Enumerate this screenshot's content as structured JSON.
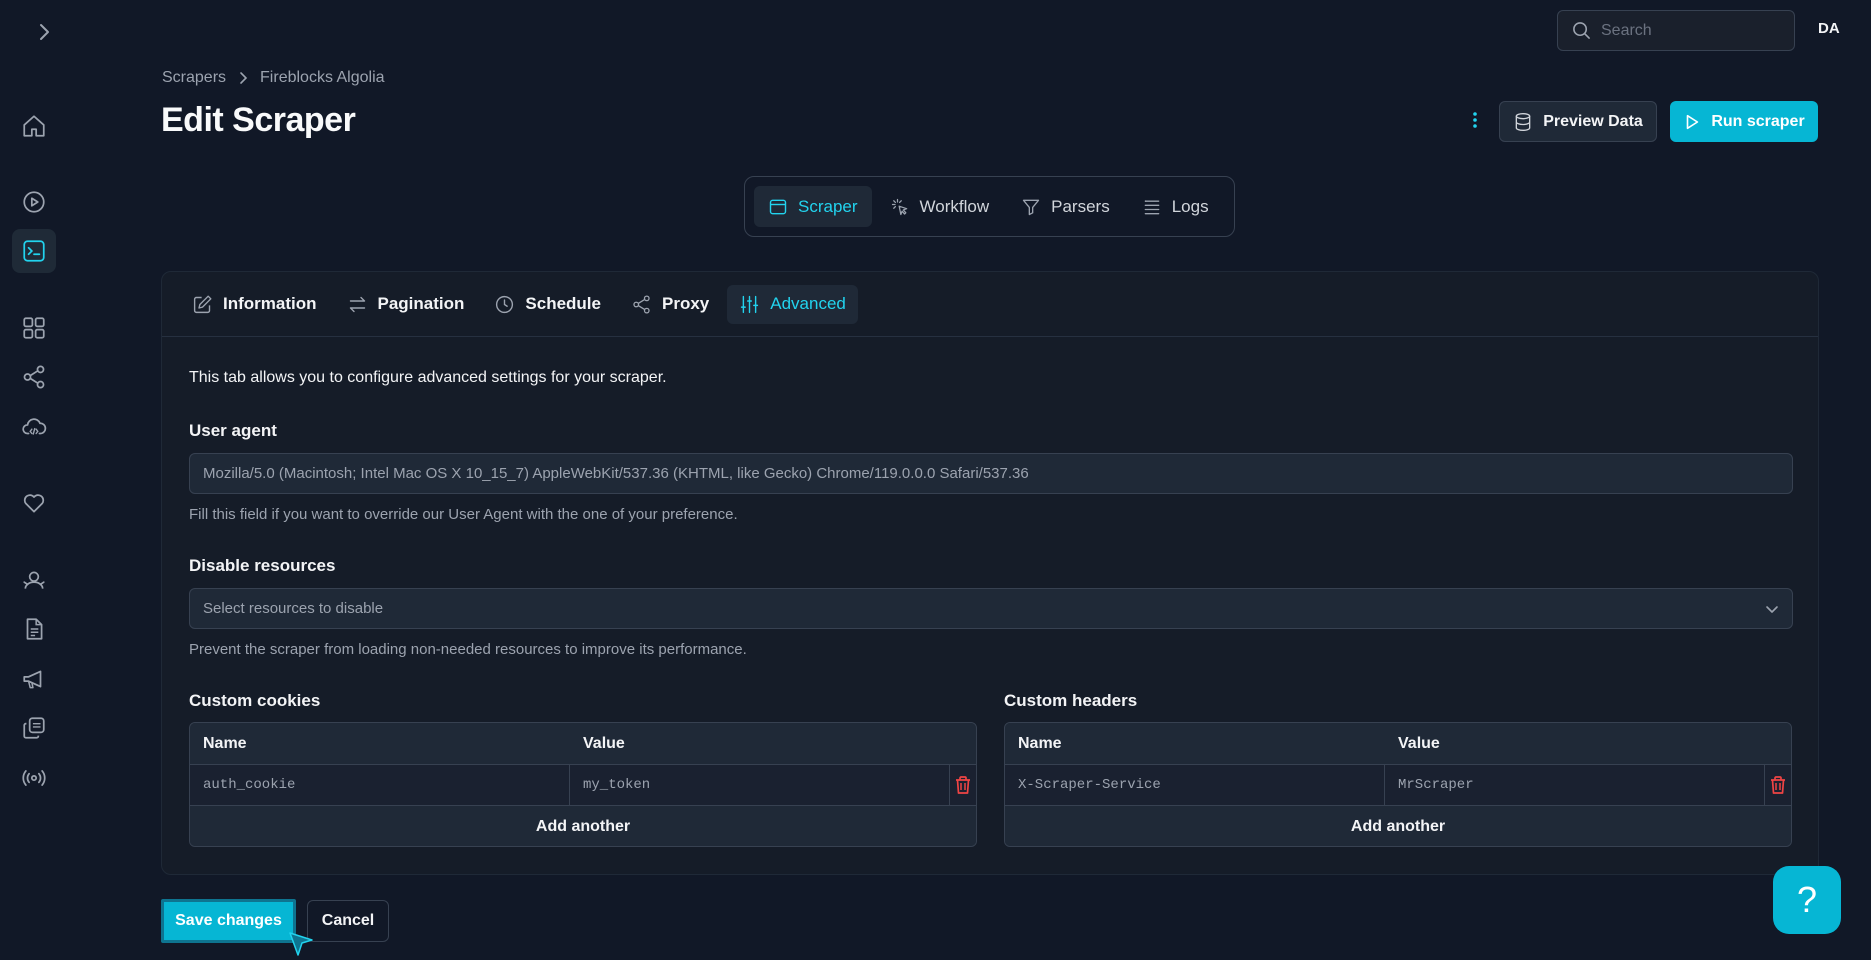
{
  "topbar": {
    "search_placeholder": "Search",
    "user_initials": "DA"
  },
  "sidebar": {
    "items": [
      {
        "icon": "home-icon"
      },
      {
        "icon": "play-circle-icon"
      },
      {
        "icon": "terminal-icon",
        "active": true
      },
      {
        "icon": "grid-icon"
      },
      {
        "icon": "share-icon"
      },
      {
        "icon": "cloud-code-icon"
      },
      {
        "icon": "heart-icon"
      },
      {
        "icon": "user-icon"
      },
      {
        "icon": "document-icon"
      },
      {
        "icon": "megaphone-icon"
      },
      {
        "icon": "copy-icon"
      },
      {
        "icon": "broadcast-icon"
      }
    ]
  },
  "breadcrumb": {
    "parent": "Scrapers",
    "current": "Fireblocks Algolia"
  },
  "page": {
    "title": "Edit Scraper"
  },
  "actions": {
    "preview_label": "Preview Data",
    "run_label": "Run scraper"
  },
  "main_tabs": [
    {
      "label": "Scraper",
      "active": true
    },
    {
      "label": "Workflow"
    },
    {
      "label": "Parsers"
    },
    {
      "label": "Logs"
    }
  ],
  "sub_tabs": [
    {
      "label": "Information"
    },
    {
      "label": "Pagination"
    },
    {
      "label": "Schedule"
    },
    {
      "label": "Proxy"
    },
    {
      "label": "Advanced",
      "active": true
    }
  ],
  "advanced": {
    "intro": "This tab allows you to configure advanced settings for your scraper.",
    "user_agent": {
      "label": "User agent",
      "placeholder": "Mozilla/5.0 (Macintosh; Intel Mac OS X 10_15_7) AppleWebKit/537.36 (KHTML, like Gecko) Chrome/119.0.0.0 Safari/537.36",
      "help": "Fill this field if you want to override our User Agent with the one of your preference."
    },
    "disable_resources": {
      "label": "Disable resources",
      "placeholder": "Select resources to disable",
      "help": "Prevent the scraper from loading non-needed resources to improve its performance."
    },
    "custom_cookies": {
      "label": "Custom cookies",
      "col_name": "Name",
      "col_value": "Value",
      "rows": [
        {
          "name": "auth_cookie",
          "value": "my_token"
        }
      ],
      "add_label": "Add another"
    },
    "custom_headers": {
      "label": "Custom headers",
      "col_name": "Name",
      "col_value": "Value",
      "rows": [
        {
          "name": "X-Scraper-Service",
          "value": "MrScraper"
        }
      ],
      "add_label": "Add another"
    }
  },
  "footer": {
    "save_label": "Save changes",
    "cancel_label": "Cancel"
  },
  "help_fab": {
    "label": "?"
  },
  "colors": {
    "background": "#111827",
    "accent": "#06b6d4",
    "accent_text": "#22d3ee",
    "delete": "#ef4444"
  }
}
